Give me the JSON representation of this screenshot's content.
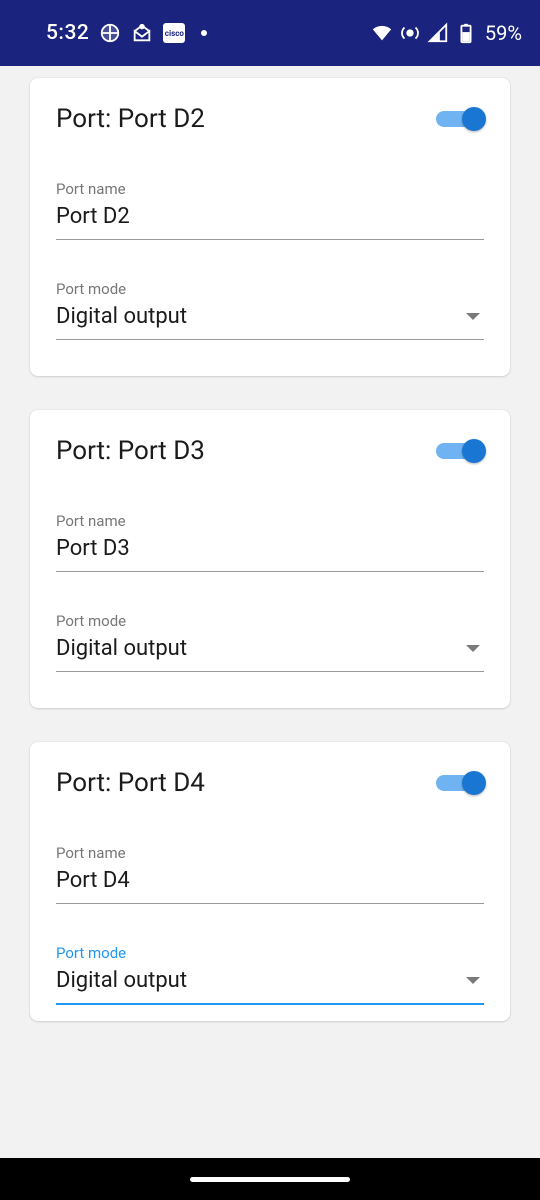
{
  "status": {
    "time": "5:32",
    "battery": "59%",
    "badge": "cisco"
  },
  "ports": [
    {
      "title": "Port: Port D2",
      "toggle": true,
      "name_label": "Port name",
      "name_value": "Port D2",
      "mode_label": "Port mode",
      "mode_value": "Digital output",
      "mode_active": false
    },
    {
      "title": "Port: Port D3",
      "toggle": true,
      "name_label": "Port name",
      "name_value": "Port D3",
      "mode_label": "Port mode",
      "mode_value": "Digital output",
      "mode_active": false
    },
    {
      "title": "Port: Port D4",
      "toggle": true,
      "name_label": "Port name",
      "name_value": "Port D4",
      "mode_label": "Port mode",
      "mode_value": "Digital output",
      "mode_active": true
    }
  ]
}
